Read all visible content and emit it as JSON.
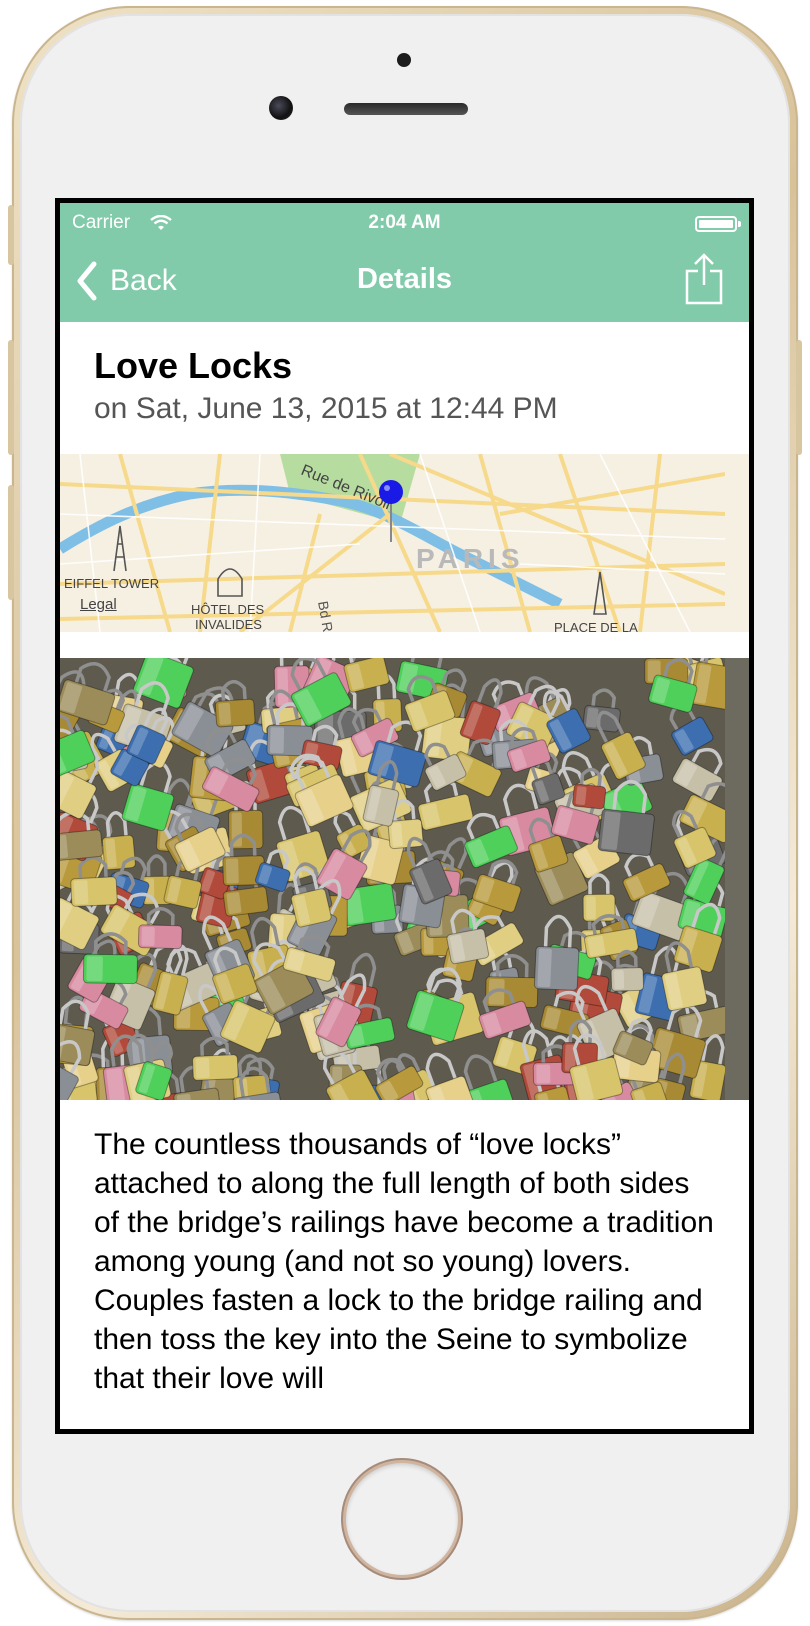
{
  "status_bar": {
    "carrier": "Carrier",
    "time": "2:04 AM"
  },
  "nav": {
    "back_label": "Back",
    "title": "Details",
    "share_icon": "share-icon",
    "tint": "#81cbaa"
  },
  "entry": {
    "title": "Love Locks",
    "date": "on Sat, June 13, 2015 at 12:44 PM",
    "description": "The countless thousands of “love locks” attached to along the full length of both sides of the bridge’s railings have become a tradition among young (and not so young) lovers. Couples fasten a lock to the bridge railing and then toss the key into the Seine to symbolize that their love will"
  },
  "map": {
    "labels": {
      "street": "Rue de Rivoli",
      "city": "PARIS",
      "eiffel": "EIFFEL TOWER",
      "invalides_1": "HÔTEL DES",
      "invalides_2": "INVALIDES",
      "boulevard": "Bd R",
      "place": "PLACE DE LA"
    },
    "legal": "Legal",
    "pin_color": "#1a1ae6",
    "river_color": "#7fbfe6",
    "park_color": "#b7dca0"
  },
  "photo": {
    "subject": "padlocks-on-bridge-railing"
  }
}
